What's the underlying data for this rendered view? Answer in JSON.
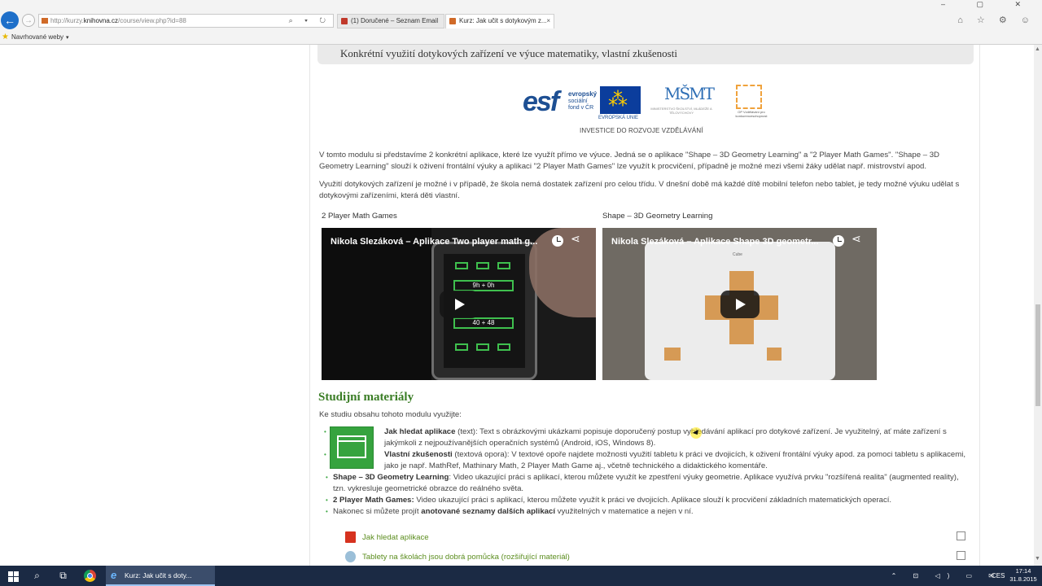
{
  "browser": {
    "url_prefix": "http://kurzy.",
    "url_host": "knihovna.cz",
    "url_path": "/course/view.php?id=88",
    "address_tools": "⌕ ▾ ↻",
    "tabs": [
      {
        "label": "(1) Doručené – Seznam Email"
      },
      {
        "label": "Kurz: Jak učit s dotykovým z..."
      }
    ],
    "tab_close": "×",
    "window_controls": "– ▢ ✕",
    "right_icons": "⌂ ☆ ⚙ ☺",
    "favorites_label": "Navrhované weby",
    "favorites_chevron": "▾",
    "favicon_colors": {
      "seznam": "#c0392b",
      "moodle": "#d06a28"
    }
  },
  "page": {
    "section_title": "Konkrétní využití dotykových zařízení ve výuce matematiky, vlastní zkušenosti",
    "logos": {
      "esf_mark": "esf",
      "esf_text_1": "evropský",
      "esf_text_2": "sociální",
      "esf_text_3": "fond v ČR",
      "eu_label": "EVROPSKÁ UNIE",
      "msmt_text": "MINISTERSTVO ŠKOLSTVÍ, MLÁDEŽE A TĚLOVÝCHOVY",
      "msmt_mark": "MŠMT",
      "op_text": "OP Vzdělávání pro konkurenceschopnost",
      "investice": "INVESTICE DO ROZVOJE VZDĚLÁVÁNÍ"
    },
    "paragraph1": "V tomto modulu si představíme 2 konkrétní aplikace, které lze využít přímo ve výuce. Jedná se o aplikace \"Shape – 3D Geometry Learning\" a \"2 Player Math Games\". \"Shape – 3D Geometry Learning\" slouží k oživení frontální výuky a aplikaci \"2 Player Math Games\" lze využít k procvičení, případně je možné mezi všemi žáky udělat např. mistrovství apod.",
    "paragraph2": "Využití dotykových zařízení je možné i v případě, že škola nemá dostatek zařízení pro celou třídu. V dnešní době má každé dítě mobilní telefon nebo tablet, je tedy možné výuku udělat s dotykovými zařízeními, která děti vlastní.",
    "videos": [
      {
        "caption": "2 Player Math Games",
        "title": "Nikola Slezáková – Aplikace Two player math g...",
        "screen": [
          "9h + 0h",
          "40 + 48"
        ]
      },
      {
        "caption": "Shape – 3D Geometry Learning",
        "title": "Nikola Slezáková – Aplikace Shape 3D geometr...",
        "screen_label": "Cube"
      }
    ],
    "share_icon": "⋖",
    "study": {
      "heading": "Studijní materiály",
      "intro": "Ke studiu obsahu tohoto modulu využijte:",
      "b1_bold": "Jak hledat aplikace",
      "b1_rest": " (text): Text s obrázkovými ukázkami popisuje doporučený postup vyhledávání aplikací pro dotykové zařízení. Je využitelný, ať máte zařízení s jakýmkoli z nejpoužívanějších operačních systémů (Android, iOS, Windows 8).",
      "b2_bold": "Vlastní zkušenosti",
      "b2_rest": " (textová opora): V textové opoře najdete možnosti využití tabletu k práci ve dvojicích, k oživení frontální výuky apod. za pomoci tabletu s aplikacemi, jako je např. MathRef, Mathinary Math, 2 Player Math Game aj., včetně technického a didaktického komentáře.",
      "b3_bold": "Shape – 3D Geometry Learning",
      "b3_rest": ": Video ukazující práci s aplikací, kterou můžete využít ke zpestření výuky geometrie. Aplikace využívá prvku \"rozšířená realita\" (augmented reality), tzn. vykresluje geometrické obrazce do reálného světa.",
      "b4_bold": "2 Player Math Games:",
      "b4_rest": " Video ukazující práci s aplikací, kterou můžete využít k práci ve dvojicích. Aplikace slouží k procvičení základních matematických operací.",
      "b5_pre": "Nakonec si můžete projít ",
      "b5_bold": "anotované seznamy dalších aplikací",
      "b5_post": " využitelných v matematice a nejen v ní."
    },
    "resources": [
      {
        "label": "Jak hledat aplikace"
      },
      {
        "label": "Tablety na školách jsou dobrá pomůcka (rozšiřující materiál)"
      }
    ],
    "accent_green": "#3a7d25",
    "link_color": "#5b8d1e"
  },
  "scrollbar": {
    "up": "▲",
    "down": "▼"
  },
  "taskbar": {
    "search_icon": "⌕",
    "taskview_icon": "⧉",
    "ie_glyph": "e",
    "ie_task_label": "Kurz: Jak učit s doty...",
    "tray_icons": "⌃ ⊡ ◁) ▭ ✉",
    "language": "CES",
    "time": "17:14",
    "date": "31.8.2015"
  }
}
